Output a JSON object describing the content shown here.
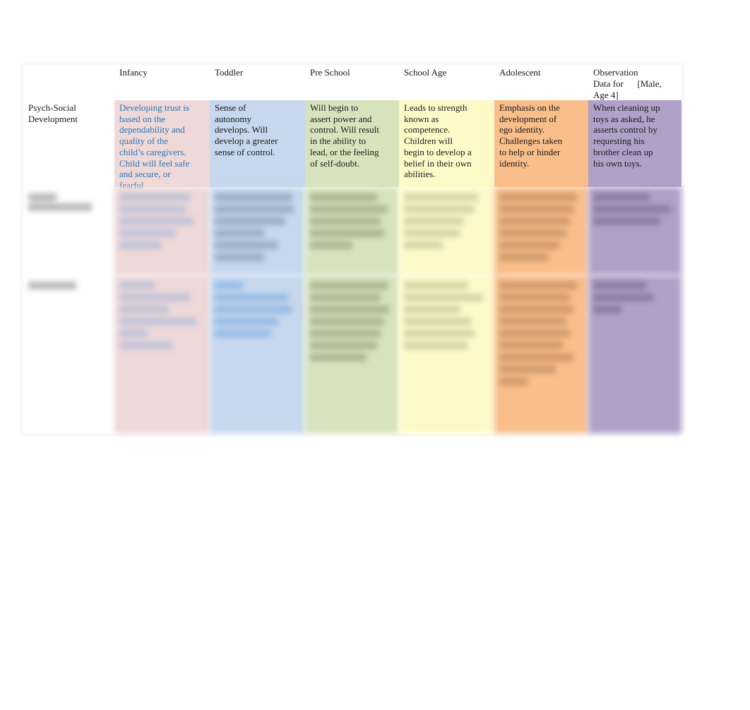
{
  "document": {
    "table": {
      "columns": [
        {
          "id": "label",
          "header": "",
          "bg": "#ffffff"
        },
        {
          "id": "infancy",
          "header": "Infancy",
          "bg": "#eed8d8"
        },
        {
          "id": "toddler",
          "header": "Toddler",
          "bg": "#c6d7ee"
        },
        {
          "id": "preschool",
          "header": "Pre School",
          "bg": "#d7e3bd"
        },
        {
          "id": "school_age",
          "header": "School Age",
          "bg": "#fdfac8"
        },
        {
          "id": "adolescent",
          "header": "Adolescent",
          "bg": "#f9be8a"
        },
        {
          "id": "observation",
          "header_line1": "Observation",
          "header_line2": "Data for      [Male,",
          "header_line3": "Age 4]",
          "bg": "#b1a1c9"
        }
      ],
      "rows": [
        {
          "label": "Psych-Social Development",
          "infancy": "Developing trust is based on the dependability and quality of the child’s caregivers. Child will feel safe and secure, or fearful",
          "toddler": "Sense of autonomy develops. Will develop a greater sense of control.",
          "preschool": "Will begin to assert power and control. Will result in the ability to lead, or the feeling of self-doubt.",
          "school_age": "Leads to strength known as competence. Children will begin to develop a belief in their own abilities.",
          "adolescent": "Emphasis on the development of ego identity. Challenges taken to help or hinder identity.",
          "observation": "When cleaning up toys as asked, he asserts control by requesting his brother clean up his own toys."
        }
      ],
      "blurred_rows": 2
    },
    "colors": {
      "infancy_text": "#2e75b6",
      "body_text": "#1a1a1a"
    }
  }
}
